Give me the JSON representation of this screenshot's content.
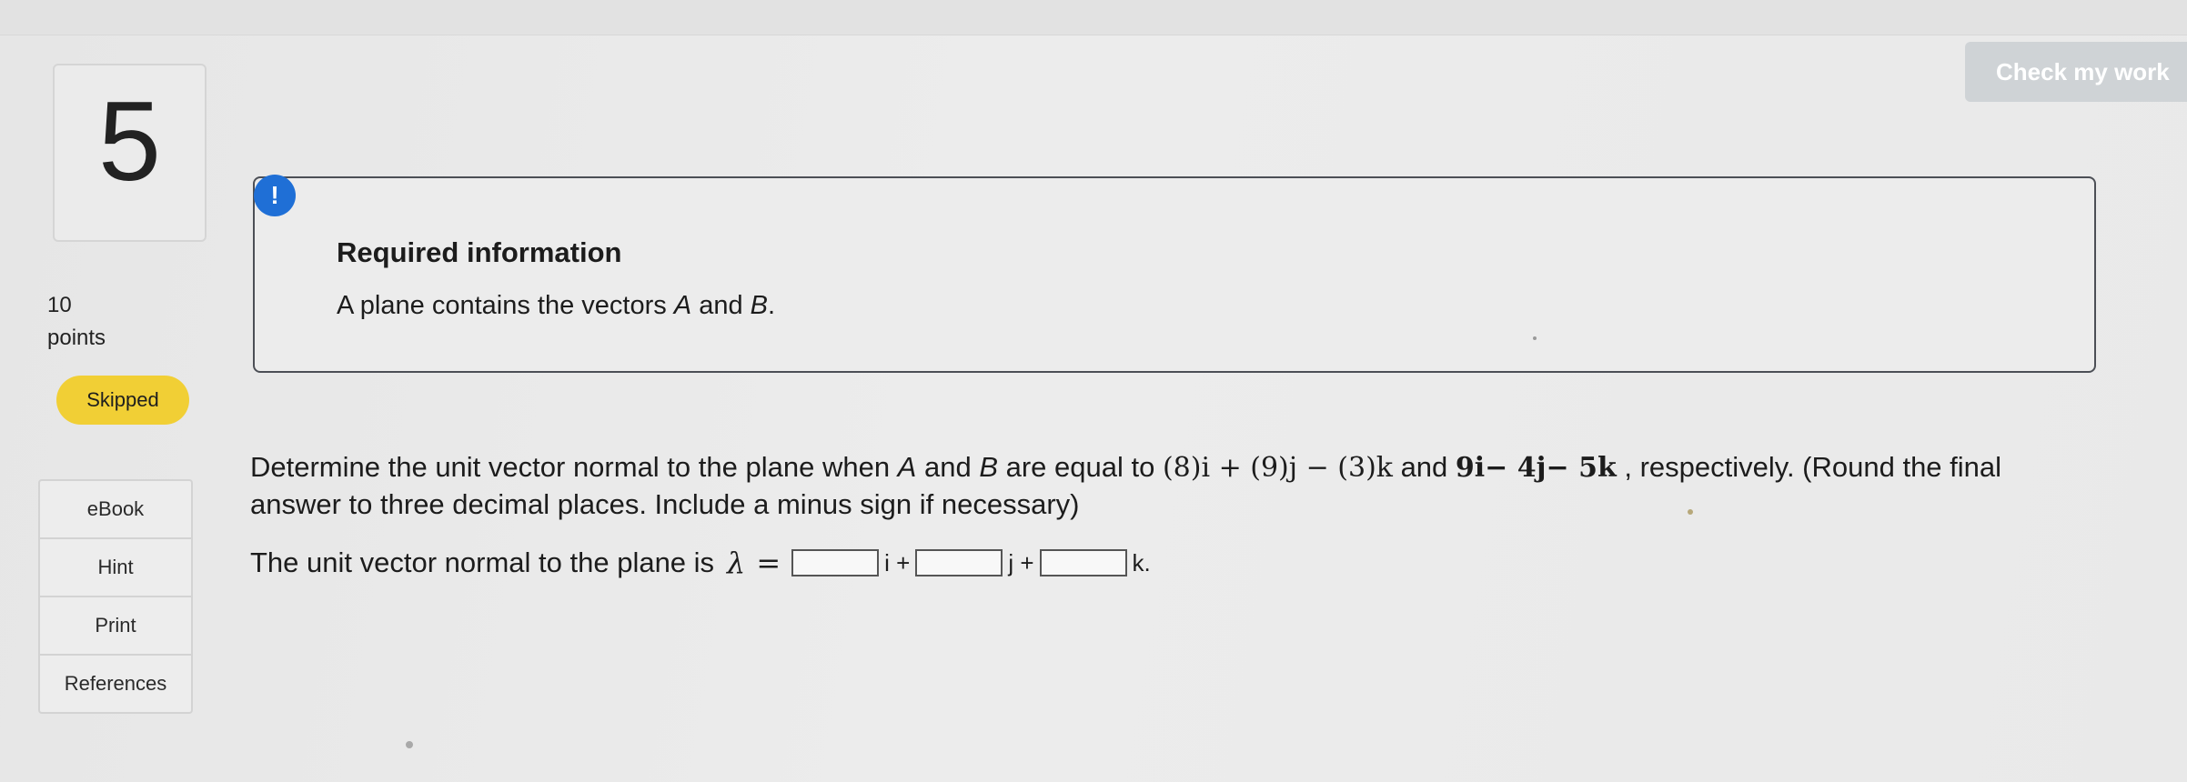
{
  "question": {
    "number": "5",
    "points_value": "10",
    "points_label": "points",
    "status": "Skipped"
  },
  "resources": [
    {
      "label": "eBook"
    },
    {
      "label": "Hint"
    },
    {
      "label": "Print"
    },
    {
      "label": "References"
    }
  ],
  "toolbar": {
    "check_label": "Check my work"
  },
  "info": {
    "icon_text": "!",
    "title": "Required information",
    "text_prefix": "A plane contains the vectors ",
    "vec_a": "A",
    "text_mid": " and ",
    "vec_b": "B",
    "text_suffix": "."
  },
  "problem": {
    "p1": "Determine the unit vector normal to the plane when ",
    "a": "A",
    "p2": " and ",
    "b": "B",
    "p3": " are equal to ",
    "expr_a": "(8)i + (9)j − (3)k",
    "p4": " and ",
    "expr_b": "9i− 4j− 5k",
    "p5": " , respectively. (Round the final answer to three decimal places. Include a minus sign if necessary)"
  },
  "answer": {
    "lead": "The unit vector normal to the plane is",
    "symbol": "λ",
    "equals": "=",
    "i_value": "",
    "i_unit": "i +",
    "j_value": "",
    "j_unit": "j +",
    "k_value": "",
    "k_unit": "k."
  },
  "colors": {
    "accent_blue": "#1f6fd6",
    "skipped_yellow": "#f1cf35",
    "check_button": "#cfd3d6"
  }
}
